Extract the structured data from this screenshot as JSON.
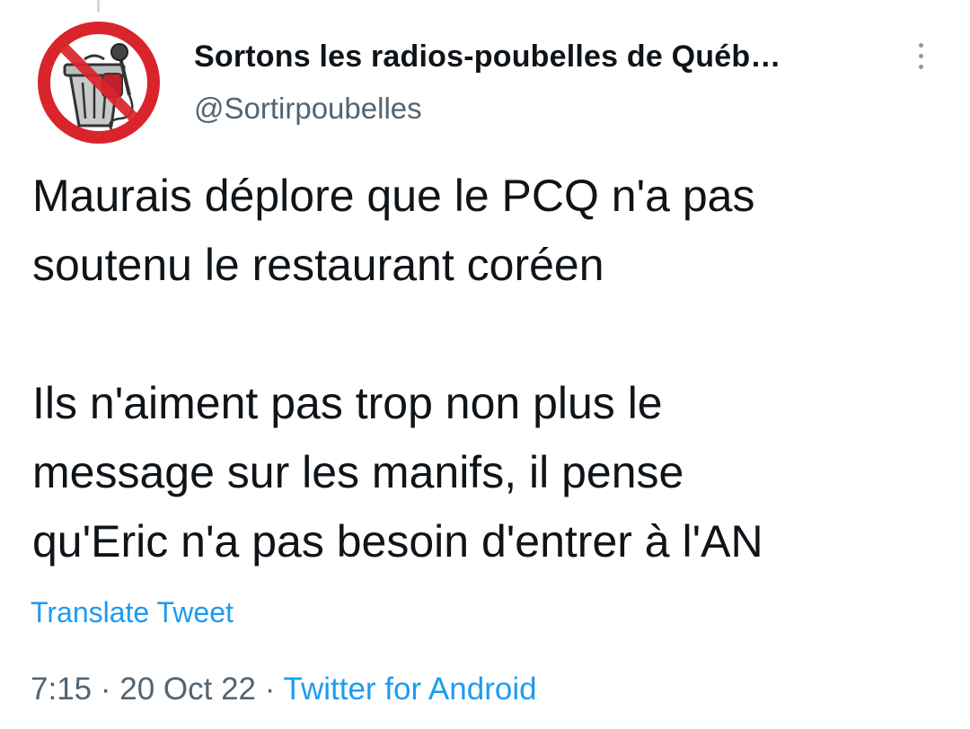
{
  "author": {
    "display_name": "Sortons les radios-poubelles de Québ…",
    "handle": "@Sortirpoubelles",
    "avatar_icon": "no-trash-radio-logo-icon"
  },
  "tweet": {
    "text": "Maurais déplore que le PCQ n'a pas\nsoutenu le restaurant coréen\n\nIls n'aiment pas trop non plus le\nmessage sur les manifs, il pense\nqu'Eric n'a pas besoin d'entrer à l'AN",
    "translate_label": "Translate Tweet",
    "time": "7:15",
    "separator": "·",
    "date": "20 Oct 22",
    "source": "Twitter for Android"
  },
  "actions": {
    "more_icon": "vertical-ellipsis-icon"
  },
  "colors": {
    "link": "#1d9bf0",
    "secondary_text": "#536471",
    "primary_text": "#0f1419",
    "avatar_ring": "#d9242b"
  }
}
